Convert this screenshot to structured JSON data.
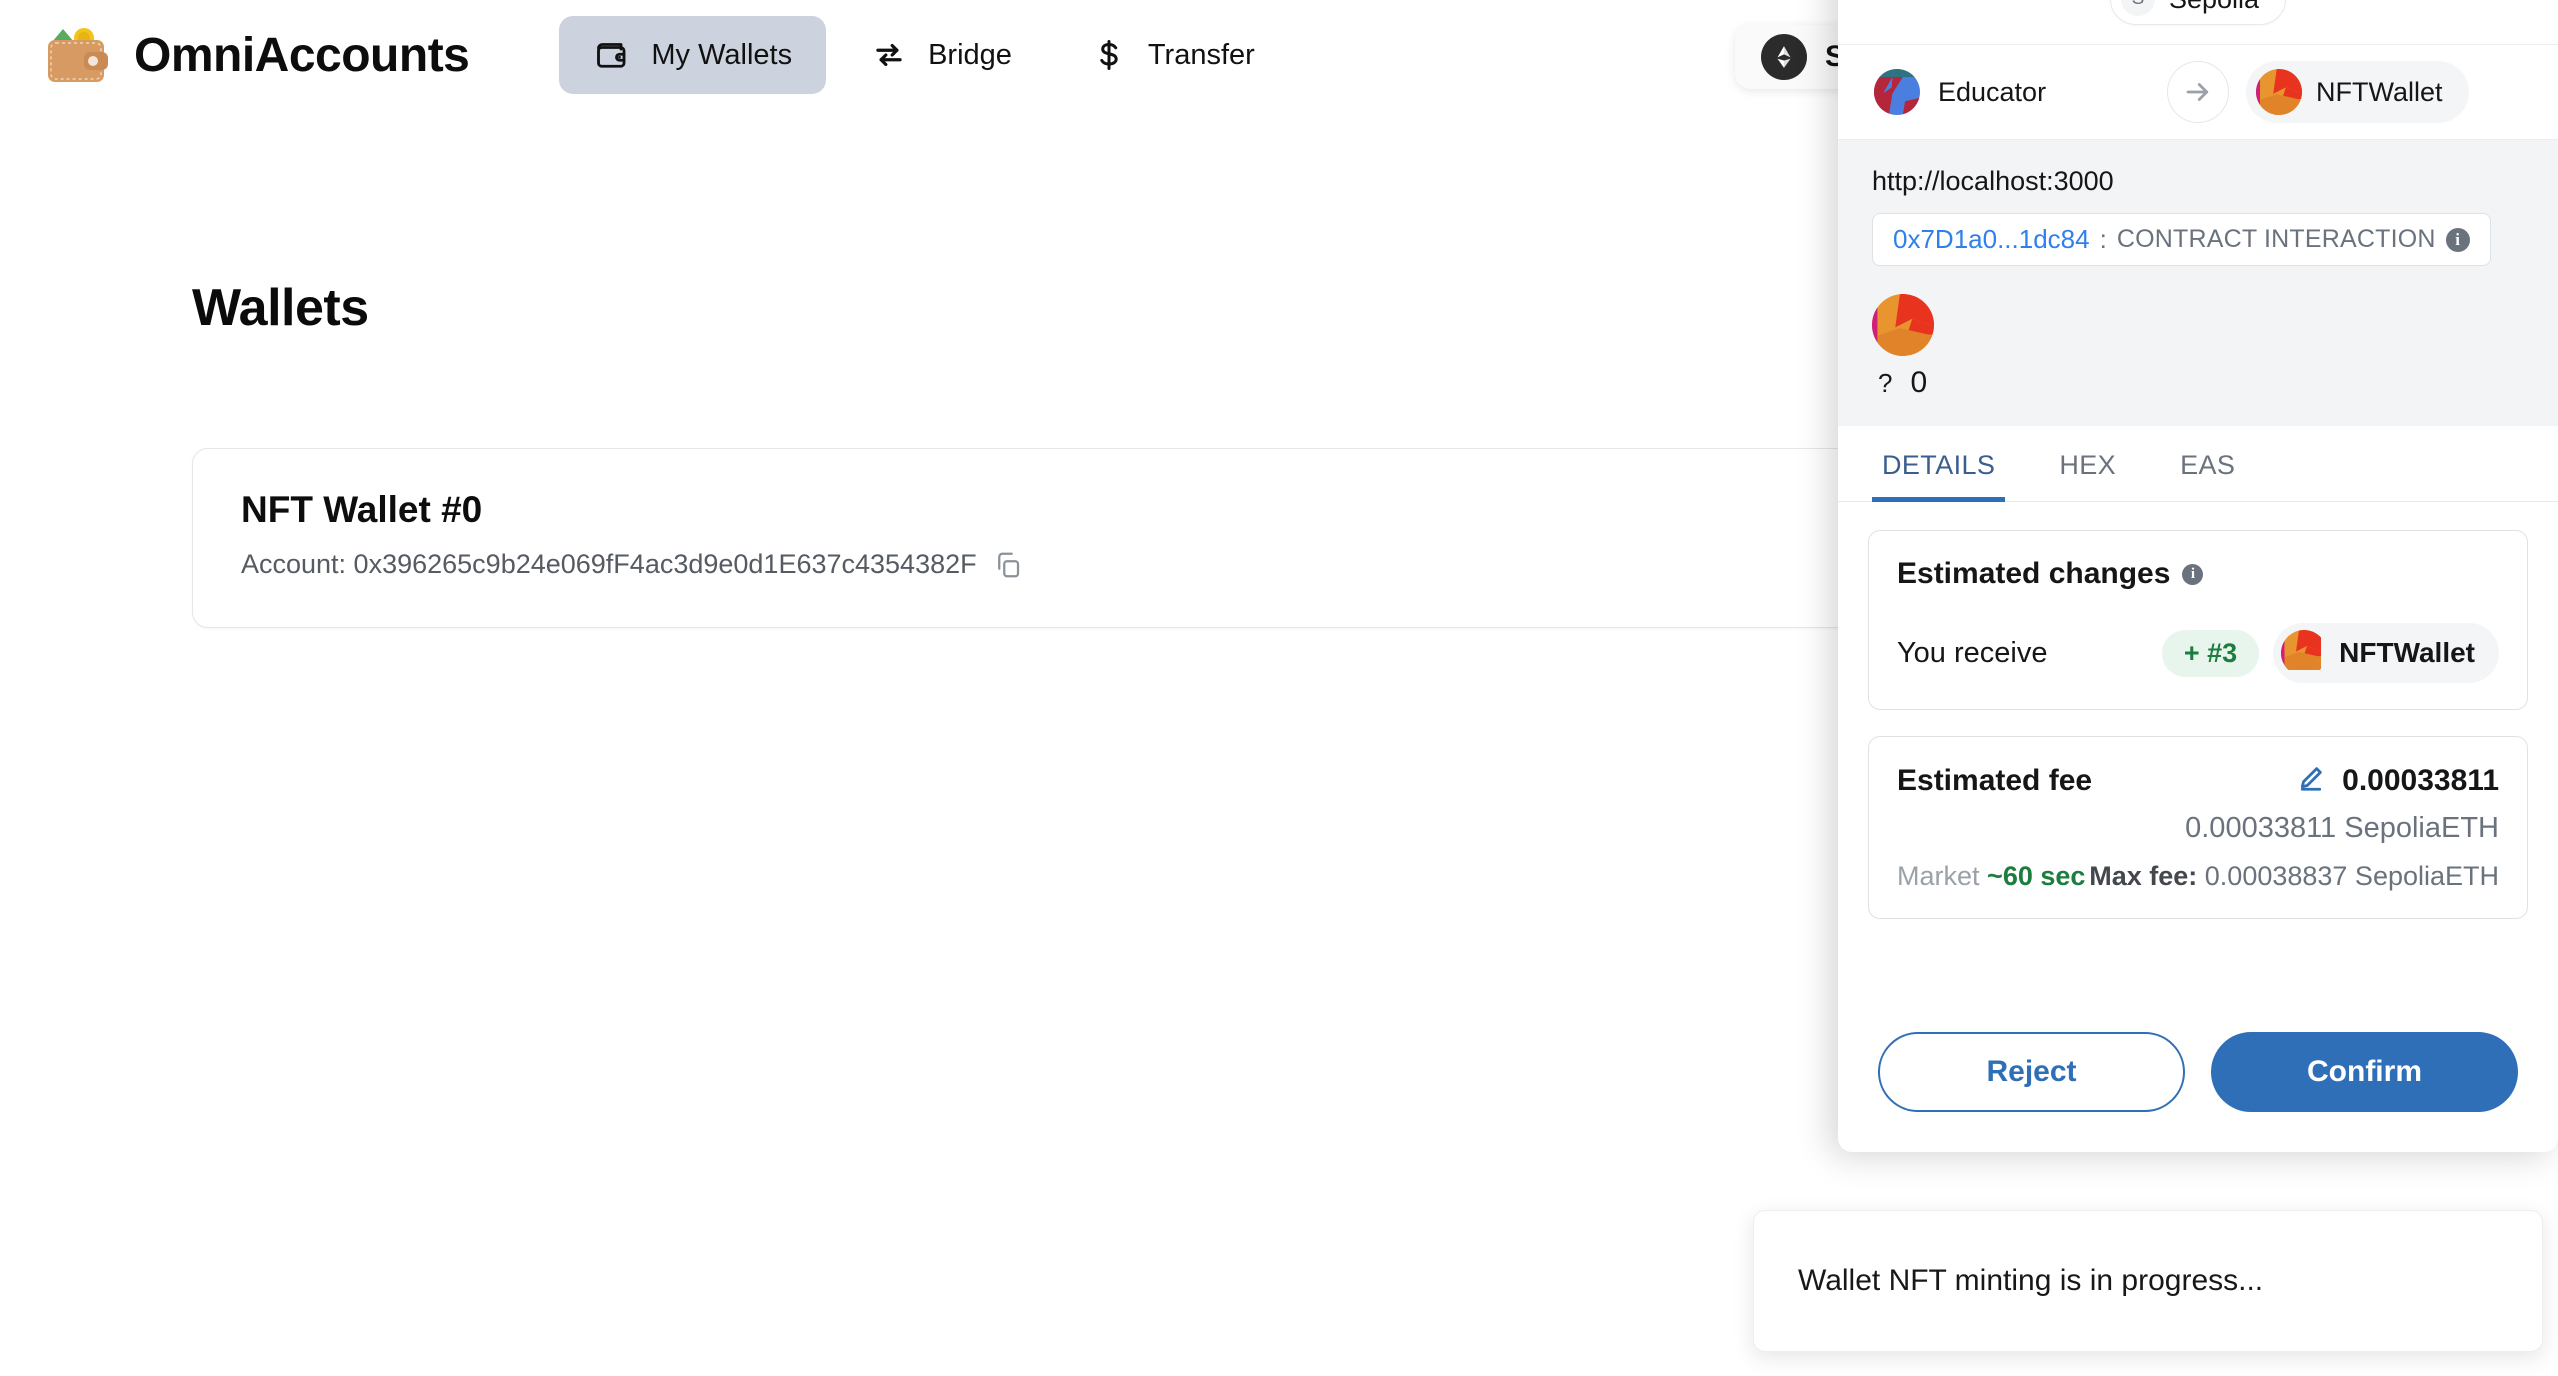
{
  "app": {
    "brand": "OmniAccounts",
    "logo_icon": "wallet-emoji-icon",
    "nav": [
      {
        "label": "My Wallets",
        "icon": "wallet-icon",
        "active": true
      },
      {
        "label": "Bridge",
        "icon": "swap-arrows-icon",
        "active": false
      },
      {
        "label": "Transfer",
        "icon": "dollar-sign-icon",
        "active": false
      }
    ],
    "network_chip": {
      "label": "Sep",
      "icon": "ethereum-icon"
    }
  },
  "main": {
    "page_title": "Wallets",
    "wallets": [
      {
        "name": "NFT Wallet #0",
        "account_label": "Account: 0x396265c9b24e069fF4ac3d9e0d1E637c4354382F",
        "copy_icon": "copy-icon"
      }
    ]
  },
  "toast": {
    "message": "Wallet NFT minting is in progress..."
  },
  "metamask": {
    "network": {
      "symbol": "S",
      "name": "Sepolia"
    },
    "from_account": "Educator",
    "to_account": "NFTWallet",
    "arrow_icon": "arrow-right-icon",
    "origin_url": "http://localhost:3000",
    "contract_address": "0x7D1a0...1dc84",
    "contract_separator": ":",
    "contract_kind": "CONTRACT INTERACTION",
    "contract_info_icon": "info-icon",
    "asset_symbol": "?",
    "asset_amount": "0",
    "tabs": [
      {
        "label": "DETAILS",
        "active": true
      },
      {
        "label": "HEX",
        "active": false
      },
      {
        "label": "EAS",
        "active": false
      }
    ],
    "estimated_changes": {
      "title": "Estimated changes",
      "info_icon": "info-icon",
      "row_label": "You receive",
      "row_badge": "+ #3",
      "row_token": "NFTWallet"
    },
    "estimated_fee": {
      "title": "Estimated fee",
      "edit_icon": "pencil-icon",
      "amount": "0.00033811",
      "amount_native": "0.00033811 SepoliaETH",
      "market_label": "Market",
      "market_time": "~60 sec",
      "max_fee_label": "Max fee:",
      "max_fee_value": "0.00038837 SepoliaETH"
    },
    "buttons": {
      "reject": "Reject",
      "confirm": "Confirm"
    }
  },
  "colors": {
    "accent_blue": "#2f6fb8",
    "link_blue": "#2f80ed",
    "green": "#1c7d3f",
    "nav_active_bg": "#cdd3de",
    "mm_panel_bg": "#f2f4f6"
  }
}
